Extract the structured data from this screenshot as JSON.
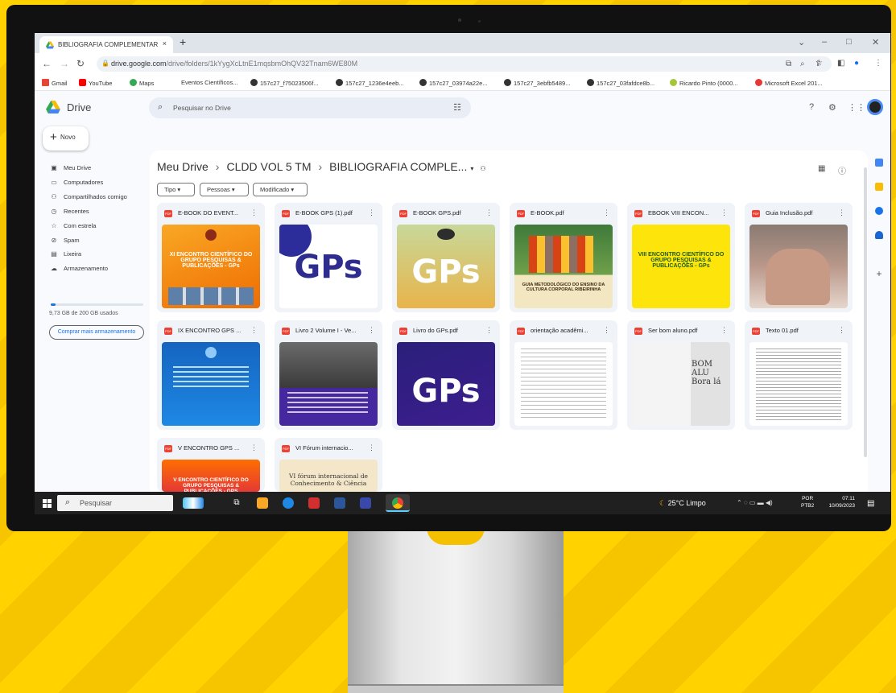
{
  "browser": {
    "tab_title": "BIBLIOGRAFIA COMPLEMENTAR",
    "tab_close": "×",
    "new_tab": "+",
    "url_host": "drive.google.com",
    "url_path": "/drive/folders/1kYygXcLtnE1mqsbmOhQV32Tnam6WE80M",
    "bookmarks": [
      {
        "label": "Gmail",
        "color": "#ea4335"
      },
      {
        "label": "YouTube",
        "color": "#ff0000"
      },
      {
        "label": "Maps",
        "color": "#34a853"
      },
      {
        "label": "Eventos Científicos...",
        "color": ""
      },
      {
        "label": "157c27_f75023506f...",
        "color": "#333333"
      },
      {
        "label": "157c27_1236e4eeb...",
        "color": "#333333"
      },
      {
        "label": "157c27_03974a22e...",
        "color": "#333333"
      },
      {
        "label": "157c27_3ebfb5489...",
        "color": "#333333"
      },
      {
        "label": "157c27_03fafdce8b...",
        "color": "#333333"
      },
      {
        "label": "Ricardo Pinto (0000...",
        "color": "#a4c639"
      },
      {
        "label": "Microsoft Excel 201...",
        "color": "#e53935"
      }
    ]
  },
  "drive": {
    "app_name": "Drive",
    "search_placeholder": "Pesquisar no Drive",
    "new_button": "Novo",
    "sidebar": [
      {
        "label": "Meu Drive",
        "icon": "my-drive-icon",
        "glyph": "▣"
      },
      {
        "label": "Computadores",
        "icon": "computer-icon",
        "glyph": "▭"
      },
      {
        "label": "Compartilhados comigo",
        "icon": "shared-icon",
        "glyph": "👥"
      },
      {
        "label": "Recentes",
        "icon": "clock-icon",
        "glyph": "◷"
      },
      {
        "label": "Com estrela",
        "icon": "star-icon",
        "glyph": "☆"
      },
      {
        "label": "Spam",
        "icon": "spam-icon",
        "glyph": "⊘"
      },
      {
        "label": "Lixeira",
        "icon": "trash-icon",
        "glyph": "🗑"
      },
      {
        "label": "Armazenamento",
        "icon": "cloud-icon",
        "glyph": "☁"
      }
    ],
    "storage_text": "9,73 GB de 200 GB usados",
    "storage_fraction": 0.049,
    "buy_storage": "Comprar mais armazenamento",
    "breadcrumb": [
      "Meu Drive",
      "CLDD VOL 5 TM",
      "BIBLIOGRAFIA COMPLE..."
    ],
    "filters": [
      "Tipo",
      "Pessoas",
      "Modificado"
    ],
    "files": [
      {
        "title": "E-BOOK DO EVENT...",
        "thumb_text": "XI ENCONTRO CIENTÍFICO DO GRUPO PESQUISAS & PUBLICAÇÕES - GPs",
        "thumb": "orange"
      },
      {
        "title": "E-BOOK GPS (1).pdf",
        "thumb_text": "GPs",
        "thumb": "gps-white"
      },
      {
        "title": "E-BOOK GPS.pdf",
        "thumb_text": "GPs",
        "thumb": "gps-green"
      },
      {
        "title": "E-BOOK.pdf",
        "thumb_text": "GUIA METODOLÓGICO DO ENSINO DA CULTURA CORPORAL RIBEIRINHA",
        "thumb": "photo-kids"
      },
      {
        "title": "EBOOK VIII ENCON...",
        "thumb_text": "VIII ENCONTRO CIENTÍFICO DO GRUPO PESQUISAS & PUBLICAÇÕES - GPs",
        "thumb": "yellow"
      },
      {
        "title": "Guia Inclusão.pdf",
        "thumb_text": "",
        "thumb": "photo-hands"
      },
      {
        "title": "IX ENCONTRO GPS ...",
        "thumb_text": "",
        "thumb": "blue"
      },
      {
        "title": "Livro 2 Volume I - Ve...",
        "thumb_text": "",
        "thumb": "photo-crowd"
      },
      {
        "title": "Livro do GPs.pdf",
        "thumb_text": "GPs",
        "thumb": "gps-purple"
      },
      {
        "title": "orientação acadêmi...",
        "thumb_text": "",
        "thumb": "doc"
      },
      {
        "title": "Ser bom aluno.pdf",
        "thumb_text": "BOM ALU Bora lá",
        "thumb": "scan"
      },
      {
        "title": "Texto 01.pdf",
        "thumb_text": "",
        "thumb": "doc"
      },
      {
        "title": "V ENCONTRO GPS ...",
        "thumb_text": "V ENCONTRO CIENTÍFICO DO GRUPO PESQUISAS & PUBLICAÇÕES - GPS",
        "thumb": "orange-red"
      },
      {
        "title": "VI Fórum internacio...",
        "thumb_text": "VI fórum internacional de Conhecimento & Ciência",
        "thumb": "beige"
      }
    ]
  },
  "taskbar": {
    "search_label": "Pesquisar",
    "weather": "25°C  Limpo",
    "lang": [
      "POR",
      "PTB2"
    ],
    "time": "07:11",
    "date": "10/09/2023"
  },
  "colors": {
    "accent": "#1a73e8",
    "pdf_red": "#ea4335"
  }
}
